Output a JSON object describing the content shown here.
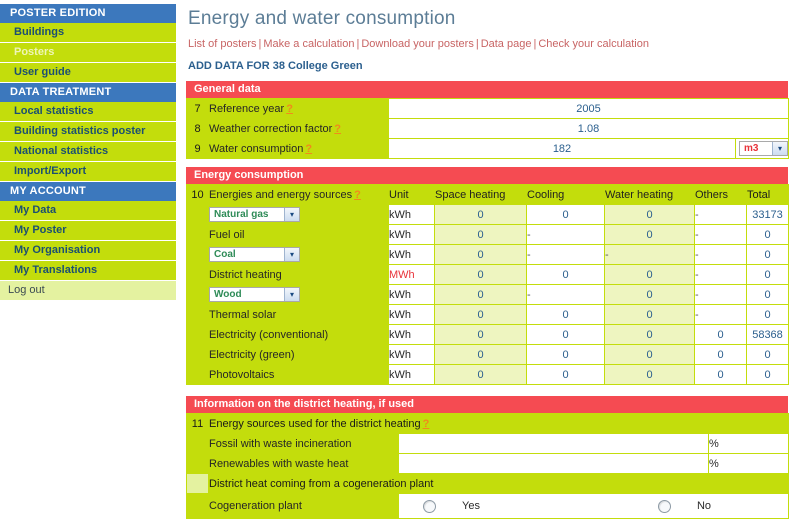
{
  "sidebar": {
    "groups": [
      {
        "title": "POSTER EDITION",
        "items": [
          {
            "label": "Buildings",
            "active": false
          },
          {
            "label": "Posters",
            "active": true
          },
          {
            "label": "User guide",
            "active": false
          }
        ]
      },
      {
        "title": "DATA TREATMENT",
        "items": [
          {
            "label": "Local statistics",
            "active": false
          },
          {
            "label": "Building statistics poster",
            "active": false
          },
          {
            "label": "National statistics",
            "active": false
          },
          {
            "label": "Import/Export",
            "active": false
          }
        ]
      },
      {
        "title": "MY ACCOUNT",
        "items": [
          {
            "label": "My Data",
            "active": false
          },
          {
            "label": "My Poster",
            "active": false
          },
          {
            "label": "My Organisation",
            "active": false
          },
          {
            "label": "My Translations",
            "active": false
          }
        ]
      }
    ],
    "logout": "Log out"
  },
  "header": {
    "title": "Energy and water consumption",
    "breadcrumb": [
      "List of posters",
      "Make a calculation",
      "Download your posters",
      "Data page",
      "Check your calculation"
    ],
    "separator": "|",
    "subtitle": "ADD DATA FOR 38 College Green"
  },
  "general_data": {
    "bar_title": "General data",
    "help_marker": "?",
    "rows": [
      {
        "num": "7",
        "label": "Reference year",
        "help": true,
        "value": "2005",
        "unit": null
      },
      {
        "num": "8",
        "label": "Weather correction factor",
        "help": true,
        "value": "1.08",
        "unit": null
      },
      {
        "num": "9",
        "label": "Water consumption",
        "help": true,
        "value": "182",
        "unit": "m3"
      }
    ]
  },
  "energy_consumption": {
    "bar_title": "Energy consumption",
    "row_num": "10",
    "main_header": "Energies and energy sources",
    "help_marker": "?",
    "columns": [
      "Unit",
      "Space heating",
      "Cooling",
      "Water heating",
      "Others",
      "Total"
    ],
    "rows": [
      {
        "source": "Natural gas",
        "selectable": true,
        "unit": "kWh",
        "unit_red": false,
        "space_heating": "0",
        "cooling": "0",
        "water_heating": "0",
        "others": "-",
        "total": "33173"
      },
      {
        "source": "Fuel oil",
        "selectable": false,
        "unit": "kWh",
        "unit_red": false,
        "space_heating": "0",
        "cooling": "-",
        "water_heating": "0",
        "others": "-",
        "total": "0"
      },
      {
        "source": "Coal",
        "selectable": true,
        "unit": "kWh",
        "unit_red": false,
        "space_heating": "0",
        "cooling": "-",
        "water_heating": "-",
        "others": "-",
        "total": "0"
      },
      {
        "source": "District heating",
        "selectable": false,
        "unit": "MWh",
        "unit_red": true,
        "space_heating": "0",
        "cooling": "0",
        "water_heating": "0",
        "others": "-",
        "total": "0"
      },
      {
        "source": "Wood",
        "selectable": true,
        "unit": "kWh",
        "unit_red": false,
        "space_heating": "0",
        "cooling": "-",
        "water_heating": "0",
        "others": "-",
        "total": "0"
      },
      {
        "source": "Thermal solar",
        "selectable": false,
        "unit": "kWh",
        "unit_red": false,
        "space_heating": "0",
        "cooling": "0",
        "water_heating": "0",
        "others": "-",
        "total": "0"
      },
      {
        "source": "Electricity (conventional)",
        "selectable": false,
        "unit": "kWh",
        "unit_red": false,
        "space_heating": "0",
        "cooling": "0",
        "water_heating": "0",
        "others": "0",
        "total": "58368"
      },
      {
        "source": "Electricity (green)",
        "selectable": false,
        "unit": "kWh",
        "unit_red": false,
        "space_heating": "0",
        "cooling": "0",
        "water_heating": "0",
        "others": "0",
        "total": "0"
      },
      {
        "source": "Photovoltaics",
        "selectable": false,
        "unit": "kWh",
        "unit_red": false,
        "space_heating": "0",
        "cooling": "0",
        "water_heating": "0",
        "others": "0",
        "total": "0"
      }
    ]
  },
  "district_heating": {
    "bar_title": "Information on the district heating, if used",
    "row_num": "11",
    "main_header": "Energy sources used for the district heating",
    "help_marker": "?",
    "rows": [
      {
        "label": "Fossil with waste incineration",
        "value": "",
        "unit": "%"
      },
      {
        "label": "Renewables with waste heat",
        "value": "",
        "unit": "%"
      }
    ],
    "cogeneration_header": "District heat coming from a cogeneration plant",
    "cogeneration_label": "Cogeneration plant",
    "cogeneration_options": [
      "Yes",
      "No"
    ],
    "cogeneration_selected": null
  },
  "colors": {
    "nav_section": "#3c78bd",
    "nav_item": "#c3dd0c",
    "bar_red": "#f54b52",
    "title_blue": "#5c7d96",
    "link_red": "#c86464",
    "value_blue": "#2b5f8e",
    "help_orange": "#f08a1c",
    "unit_red": "#e8333a",
    "shade_green": "#eef5c0"
  },
  "icons": {
    "chevron_down": "▾"
  }
}
